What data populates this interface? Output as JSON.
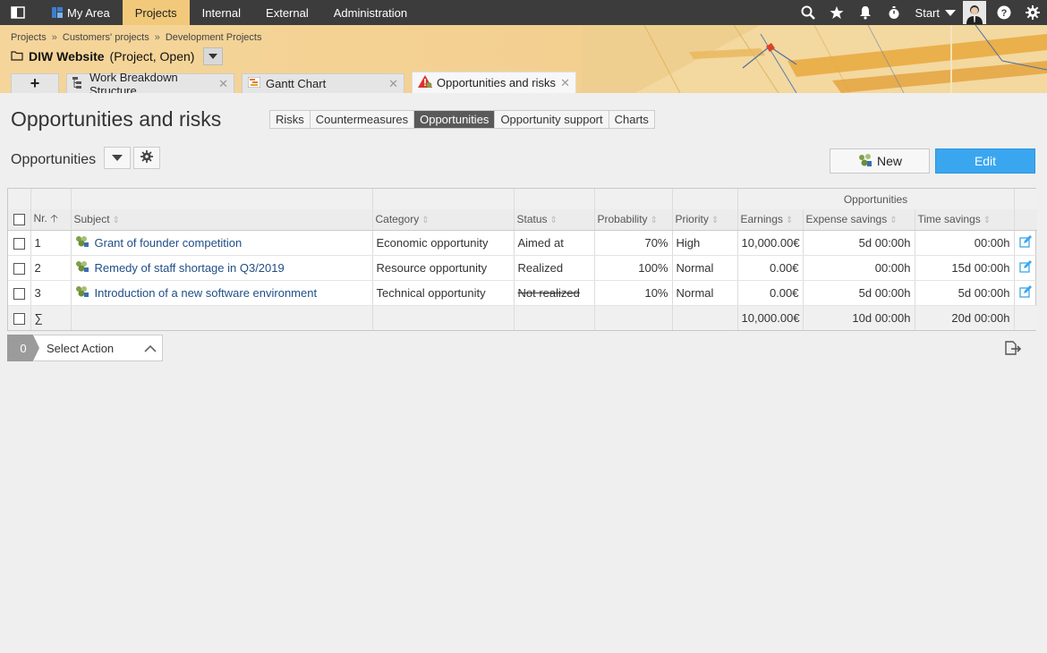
{
  "topnav": {
    "items": [
      {
        "label": "My Area"
      },
      {
        "label": "Projects"
      },
      {
        "label": "Internal"
      },
      {
        "label": "External"
      },
      {
        "label": "Administration"
      }
    ],
    "start_label": "Start"
  },
  "header": {
    "breadcrumb": [
      "Projects",
      "Customers' projects",
      "Development Projects"
    ],
    "breadcrumb_sep": "»",
    "project_name": "DIW Website",
    "project_state": "(Project, Open)"
  },
  "tabs": [
    {
      "label": "Work Breakdown Structure",
      "icon": "wbs-icon"
    },
    {
      "label": "Gantt Chart",
      "icon": "gantt-icon"
    },
    {
      "label": "Opportunities and risks",
      "icon": "warning-icon"
    }
  ],
  "page": {
    "title": "Opportunities and risks",
    "segments": [
      "Risks",
      "Countermeasures",
      "Opportunities",
      "Opportunity support",
      "Charts"
    ],
    "active_segment": "Opportunities",
    "subtitle": "Opportunities",
    "new_label": "New",
    "edit_label": "Edit"
  },
  "table": {
    "group_header": "Opportunities",
    "columns": [
      "Nr.",
      "Subject",
      "Category",
      "Status",
      "Probability",
      "Priority",
      "Earnings",
      "Expense savings",
      "Time savings"
    ],
    "rows": [
      {
        "nr": "1",
        "subject": "Grant of founder competition",
        "category": "Economic opportunity",
        "status": "Aimed at",
        "probability": "70%",
        "priority": "High",
        "earnings": "10,000.00€",
        "expense_savings": "5d 00:00h",
        "time_savings": "00:00h"
      },
      {
        "nr": "2",
        "subject": "Remedy of staff shortage in Q3/2019",
        "category": "Resource opportunity",
        "status": "Realized",
        "probability": "100%",
        "priority": "Normal",
        "earnings": "0.00€",
        "expense_savings": "00:00h",
        "time_savings": "15d 00:00h"
      },
      {
        "nr": "3",
        "subject": "Introduction of a new software environment",
        "category": "Technical opportunity",
        "status": "Not realized",
        "probability": "10%",
        "priority": "Normal",
        "earnings": "0.00€",
        "expense_savings": "5d 00:00h",
        "time_savings": "5d 00:00h"
      }
    ],
    "sum": {
      "symbol": "∑",
      "earnings": "10,000.00€",
      "expense_savings": "10d 00:00h",
      "time_savings": "20d 00:00h"
    }
  },
  "actions": {
    "count": "0",
    "select_label": "Select Action"
  },
  "colors": {
    "accent": "#3aa6ef",
    "nav_bg": "#3c3c3c",
    "nav_active": "#f2c97b",
    "link": "#1f4e87",
    "realized": "#7f9a4a"
  }
}
